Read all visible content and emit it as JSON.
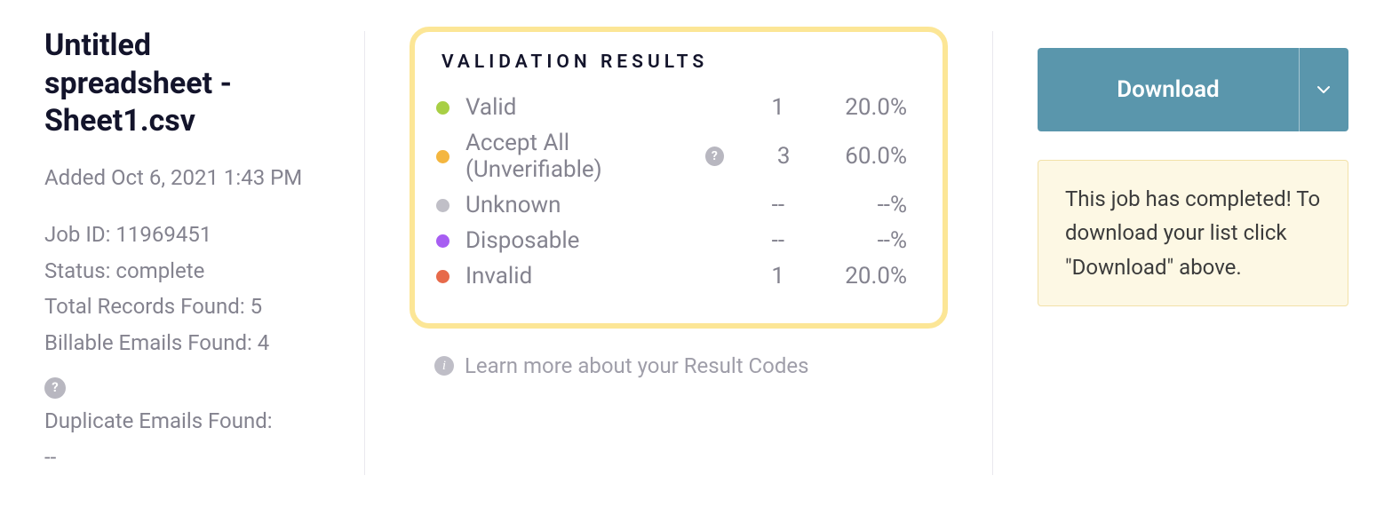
{
  "meta": {
    "title": "Untitled spreadsheet - Sheet1.csv",
    "added_prefix": "Added ",
    "added": "Oct 6, 2021 1:43 PM",
    "rows": {
      "job_id": {
        "label": "Job ID",
        "value": "11969451"
      },
      "status": {
        "label": "Status",
        "value": "complete"
      },
      "total": {
        "label": "Total Records Found",
        "value": "5"
      },
      "billable": {
        "label": "Billable Emails Found",
        "value": "4"
      },
      "duplicates": {
        "label": "Duplicate Emails Found",
        "value": "--"
      }
    }
  },
  "results": {
    "title": "VALIDATION RESULTS",
    "rows": {
      "valid": {
        "label": "Valid",
        "count": "1",
        "pct": "20.0%",
        "color": "#a8cf45"
      },
      "accept_all": {
        "label": "Accept All (Unverifiable)",
        "count": "3",
        "pct": "60.0%",
        "color": "#f4b63f",
        "help": true
      },
      "unknown": {
        "label": "Unknown",
        "count": "--",
        "pct": "--%",
        "color": "#c0bfc7"
      },
      "disposable": {
        "label": "Disposable",
        "count": "--",
        "pct": "--%",
        "color": "#a75ef2"
      },
      "invalid": {
        "label": "Invalid",
        "count": "1",
        "pct": "20.0%",
        "color": "#e76a4a"
      }
    },
    "learn_more": "Learn more about your Result Codes"
  },
  "right": {
    "download": "Download",
    "notice": "This job has completed! To download your list click \"Download\" above."
  }
}
